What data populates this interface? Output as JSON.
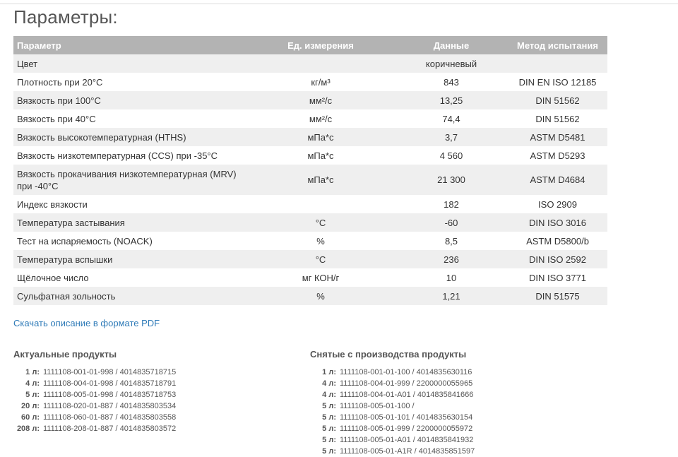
{
  "page": {
    "title": "Параметры:"
  },
  "table": {
    "headers": [
      "Параметр",
      "Ед. измерения",
      "Данные",
      "Метод испытания"
    ],
    "rows": [
      [
        "Цвет",
        "",
        "коричневый",
        ""
      ],
      [
        "Плотность при 20°C",
        "кг/м³",
        "843",
        "DIN EN ISO 12185"
      ],
      [
        "Вязкость при 100°C",
        "мм²/с",
        "13,25",
        "DIN 51562"
      ],
      [
        "Вязкость при 40°C",
        "мм²/с",
        "74,4",
        "DIN 51562"
      ],
      [
        "Вязкость высокотемпературная (HTHS)",
        "мПа*с",
        "3,7",
        "ASTM D5481"
      ],
      [
        "Вязкость низкотемпературная (CCS) при -35°C",
        "мПа*с",
        "4 560",
        "ASTM D5293"
      ],
      [
        "Вязкость прокачивания низкотемпературная (MRV) при -40°C",
        "мПа*с",
        "21 300",
        "ASTM D4684"
      ],
      [
        "Индекс вязкости",
        "",
        "182",
        "ISO 2909"
      ],
      [
        "Температура застывания",
        "°C",
        "-60",
        "DIN ISO 3016"
      ],
      [
        "Тест на испаряемость (NOACK)",
        "%",
        "8,5",
        "ASTM D5800/b"
      ],
      [
        "Температура вспышки",
        "°C",
        "236",
        "DIN ISO 2592"
      ],
      [
        "Щёлочное число",
        "мг КОН/г",
        "10",
        "DIN ISO 3771"
      ],
      [
        "Сульфатная зольность",
        "%",
        "1,21",
        "DIN 51575"
      ]
    ]
  },
  "pdf_link": "Скачать описание в формате PDF",
  "current_products": {
    "heading": "Актуальные продукты",
    "items": [
      {
        "size": "1 л:",
        "code": "1111108-001-01-998 / 4014835718715"
      },
      {
        "size": "4 л:",
        "code": "1111108-004-01-998 / 4014835718791"
      },
      {
        "size": "5 л:",
        "code": "1111108-005-01-998 / 4014835718753"
      },
      {
        "size": "20 л:",
        "code": "1111108-020-01-887 / 4014835803534"
      },
      {
        "size": "60 л:",
        "code": "1111108-060-01-887 / 4014835803558"
      },
      {
        "size": "208 л:",
        "code": "1111108-208-01-887 / 4014835803572"
      }
    ]
  },
  "discontinued_products": {
    "heading": "Снятые с производства продукты",
    "items": [
      {
        "size": "1 л:",
        "code": "1111108-001-01-100 / 4014835630116"
      },
      {
        "size": "4 л:",
        "code": "1111108-004-01-999 / 2200000055965"
      },
      {
        "size": "4 л:",
        "code": "1111108-004-01-A01 / 4014835841666"
      },
      {
        "size": "5 л:",
        "code": "1111108-005-01-100 /"
      },
      {
        "size": "5 л:",
        "code": "1111108-005-01-101 / 4014835630154"
      },
      {
        "size": "5 л:",
        "code": "1111108-005-01-999 / 2200000055972"
      },
      {
        "size": "5 л:",
        "code": "1111108-005-01-A01 / 4014835841932"
      },
      {
        "size": "5 л:",
        "code": "1111108-005-01-A1R / 4014835851597"
      }
    ]
  }
}
